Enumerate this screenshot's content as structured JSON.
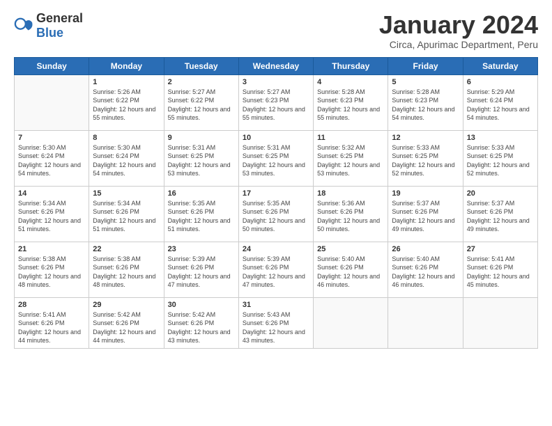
{
  "logo": {
    "general": "General",
    "blue": "Blue"
  },
  "header": {
    "month": "January 2024",
    "location": "Circa, Apurimac Department, Peru"
  },
  "days_of_week": [
    "Sunday",
    "Monday",
    "Tuesday",
    "Wednesday",
    "Thursday",
    "Friday",
    "Saturday"
  ],
  "weeks": [
    [
      {
        "day": "",
        "empty": true
      },
      {
        "day": "1",
        "sunrise": "5:26 AM",
        "sunset": "6:22 PM",
        "daylight": "12 hours and 55 minutes."
      },
      {
        "day": "2",
        "sunrise": "5:27 AM",
        "sunset": "6:22 PM",
        "daylight": "12 hours and 55 minutes."
      },
      {
        "day": "3",
        "sunrise": "5:27 AM",
        "sunset": "6:23 PM",
        "daylight": "12 hours and 55 minutes."
      },
      {
        "day": "4",
        "sunrise": "5:28 AM",
        "sunset": "6:23 PM",
        "daylight": "12 hours and 55 minutes."
      },
      {
        "day": "5",
        "sunrise": "5:28 AM",
        "sunset": "6:23 PM",
        "daylight": "12 hours and 54 minutes."
      },
      {
        "day": "6",
        "sunrise": "5:29 AM",
        "sunset": "6:24 PM",
        "daylight": "12 hours and 54 minutes."
      }
    ],
    [
      {
        "day": "7",
        "sunrise": "5:30 AM",
        "sunset": "6:24 PM",
        "daylight": "12 hours and 54 minutes."
      },
      {
        "day": "8",
        "sunrise": "5:30 AM",
        "sunset": "6:24 PM",
        "daylight": "12 hours and 54 minutes."
      },
      {
        "day": "9",
        "sunrise": "5:31 AM",
        "sunset": "6:25 PM",
        "daylight": "12 hours and 53 minutes."
      },
      {
        "day": "10",
        "sunrise": "5:31 AM",
        "sunset": "6:25 PM",
        "daylight": "12 hours and 53 minutes."
      },
      {
        "day": "11",
        "sunrise": "5:32 AM",
        "sunset": "6:25 PM",
        "daylight": "12 hours and 53 minutes."
      },
      {
        "day": "12",
        "sunrise": "5:33 AM",
        "sunset": "6:25 PM",
        "daylight": "12 hours and 52 minutes."
      },
      {
        "day": "13",
        "sunrise": "5:33 AM",
        "sunset": "6:25 PM",
        "daylight": "12 hours and 52 minutes."
      }
    ],
    [
      {
        "day": "14",
        "sunrise": "5:34 AM",
        "sunset": "6:26 PM",
        "daylight": "12 hours and 51 minutes."
      },
      {
        "day": "15",
        "sunrise": "5:34 AM",
        "sunset": "6:26 PM",
        "daylight": "12 hours and 51 minutes."
      },
      {
        "day": "16",
        "sunrise": "5:35 AM",
        "sunset": "6:26 PM",
        "daylight": "12 hours and 51 minutes."
      },
      {
        "day": "17",
        "sunrise": "5:35 AM",
        "sunset": "6:26 PM",
        "daylight": "12 hours and 50 minutes."
      },
      {
        "day": "18",
        "sunrise": "5:36 AM",
        "sunset": "6:26 PM",
        "daylight": "12 hours and 50 minutes."
      },
      {
        "day": "19",
        "sunrise": "5:37 AM",
        "sunset": "6:26 PM",
        "daylight": "12 hours and 49 minutes."
      },
      {
        "day": "20",
        "sunrise": "5:37 AM",
        "sunset": "6:26 PM",
        "daylight": "12 hours and 49 minutes."
      }
    ],
    [
      {
        "day": "21",
        "sunrise": "5:38 AM",
        "sunset": "6:26 PM",
        "daylight": "12 hours and 48 minutes."
      },
      {
        "day": "22",
        "sunrise": "5:38 AM",
        "sunset": "6:26 PM",
        "daylight": "12 hours and 48 minutes."
      },
      {
        "day": "23",
        "sunrise": "5:39 AM",
        "sunset": "6:26 PM",
        "daylight": "12 hours and 47 minutes."
      },
      {
        "day": "24",
        "sunrise": "5:39 AM",
        "sunset": "6:26 PM",
        "daylight": "12 hours and 47 minutes."
      },
      {
        "day": "25",
        "sunrise": "5:40 AM",
        "sunset": "6:26 PM",
        "daylight": "12 hours and 46 minutes."
      },
      {
        "day": "26",
        "sunrise": "5:40 AM",
        "sunset": "6:26 PM",
        "daylight": "12 hours and 46 minutes."
      },
      {
        "day": "27",
        "sunrise": "5:41 AM",
        "sunset": "6:26 PM",
        "daylight": "12 hours and 45 minutes."
      }
    ],
    [
      {
        "day": "28",
        "sunrise": "5:41 AM",
        "sunset": "6:26 PM",
        "daylight": "12 hours and 44 minutes."
      },
      {
        "day": "29",
        "sunrise": "5:42 AM",
        "sunset": "6:26 PM",
        "daylight": "12 hours and 44 minutes."
      },
      {
        "day": "30",
        "sunrise": "5:42 AM",
        "sunset": "6:26 PM",
        "daylight": "12 hours and 43 minutes."
      },
      {
        "day": "31",
        "sunrise": "5:43 AM",
        "sunset": "6:26 PM",
        "daylight": "12 hours and 43 minutes."
      },
      {
        "day": "",
        "empty": true
      },
      {
        "day": "",
        "empty": true
      },
      {
        "day": "",
        "empty": true
      }
    ]
  ]
}
